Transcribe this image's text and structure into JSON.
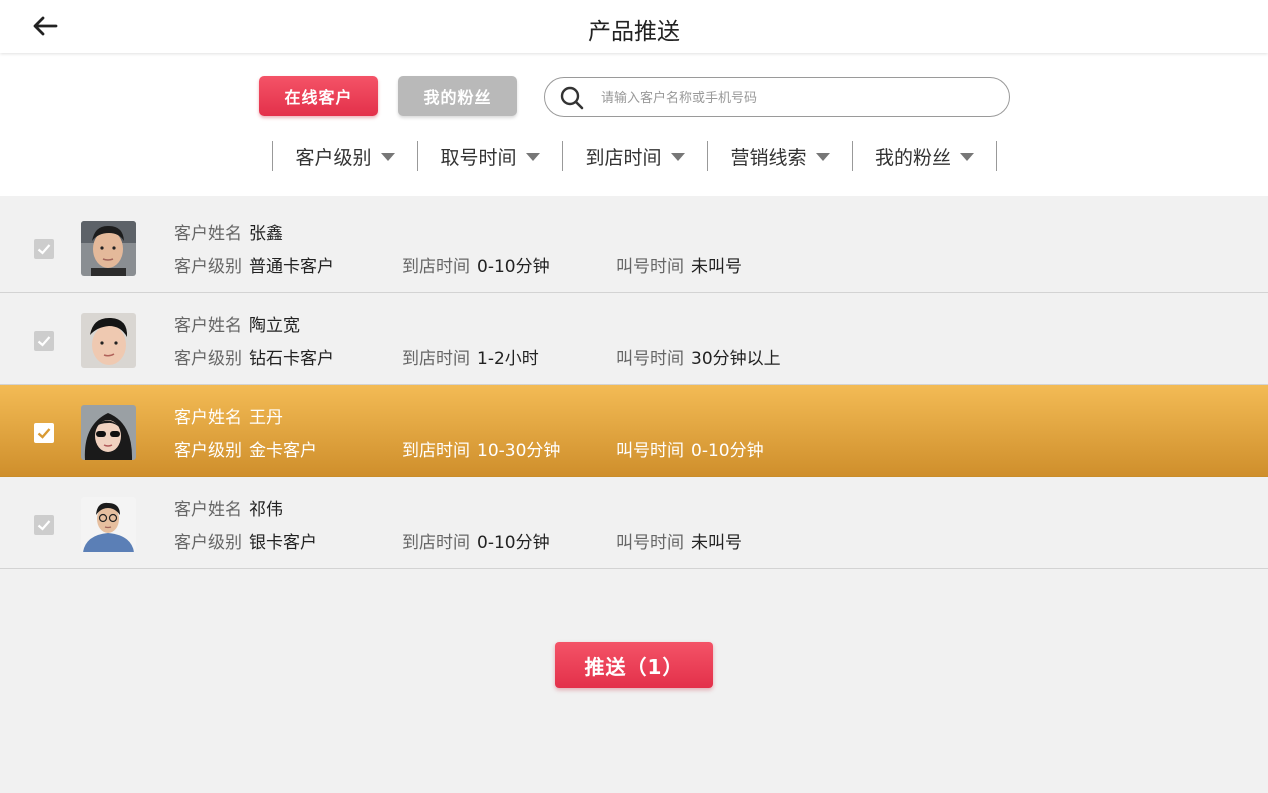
{
  "header": {
    "title": "产品推送",
    "back_icon": "arrow-left-icon"
  },
  "filters": {
    "online_customers_label": "在线客户",
    "my_fans_label": "我的粉丝",
    "search": {
      "placeholder": "请输入客户名称或手机号码",
      "value": ""
    },
    "tabs": [
      {
        "label": "客户级别"
      },
      {
        "label": "取号时间"
      },
      {
        "label": "到店时间"
      },
      {
        "label": "营销线索"
      },
      {
        "label": "我的粉丝"
      }
    ]
  },
  "field_labels": {
    "name": "客户姓名",
    "level": "客户级别",
    "arrival": "到店时间",
    "call": "叫号时间"
  },
  "customers": [
    {
      "name": "张鑫",
      "level": "普通卡客户",
      "arrival": "0-10分钟",
      "call": "未叫号",
      "selected": false
    },
    {
      "name": "陶立宽",
      "level": "钻石卡客户",
      "arrival": "1-2小时",
      "call": "30分钟以上",
      "selected": false
    },
    {
      "name": "王丹",
      "level": "金卡客户",
      "arrival": "10-30分钟",
      "call": "0-10分钟",
      "selected": true
    },
    {
      "name": "祁伟",
      "level": "银卡客户",
      "arrival": "0-10分钟",
      "call": "未叫号",
      "selected": false
    }
  ],
  "push_button": {
    "label": "推送（1）"
  },
  "colors": {
    "accent_red": "#e8374f",
    "selected_gold": "#e3a744",
    "disabled_gray": "#b9b9b9"
  }
}
